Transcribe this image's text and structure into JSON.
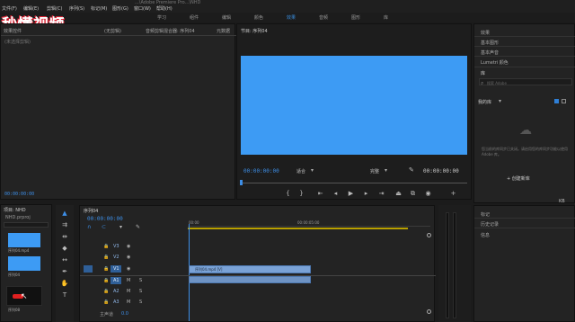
{
  "logo": "秒懂视频",
  "title_partial": "...\\Adobe Premiere Pro...\\NHD",
  "menu": [
    "文件(F)",
    "编辑(E)",
    "剪辑(C)",
    "序列(S)",
    "标记(M)",
    "图形(G)",
    "窗口(W)",
    "帮助(H)"
  ],
  "workspaces": [
    "学习",
    "组件",
    "编辑",
    "颜色",
    "效果",
    "音频",
    "图形",
    "库"
  ],
  "active_workspace": "效果",
  "source_panel": {
    "tabs": [
      "效果控件",
      "(无剪辑)",
      "音频剪辑混合器: 序列04",
      "元数据"
    ],
    "empty_text": "(未选择剪辑)",
    "timecode": "00:00:00:00"
  },
  "program_panel": {
    "title": "节目: 序列04",
    "timecode_left": "00:00:00:00",
    "fit": "适合",
    "quality": "完整",
    "timecode_right": "00:00:00:00",
    "screen_color": "#3d9bf4"
  },
  "right_panel": {
    "items": [
      "效果",
      "基本图形",
      "基本声音",
      "Lumetri 颜色"
    ],
    "library_label": "库",
    "search_placeholder": "搜索 Adobe",
    "my_libraries": "我的库",
    "message": "您当前的库同步已关闭。请启用您的库同步功能以使用 Adobe 库。",
    "create_button": "+ 创建新库",
    "bottom_items": [
      "标记",
      "历史记录",
      "信息"
    ],
    "kb_label": "KB"
  },
  "project_panel": {
    "title": "项目: NHD",
    "file": "NHD.prproj",
    "items": [
      "序列04.mp4",
      "序列04",
      "序列08"
    ]
  },
  "timeline": {
    "title": "序列04",
    "timecode": "00:00:00:00",
    "ruler_start": "00:00",
    "ruler_mark": "00:00:05:00",
    "video_tracks": [
      "V3",
      "V2",
      "V1"
    ],
    "audio_tracks": [
      "A1",
      "A2",
      "A3"
    ],
    "master": "主声道",
    "master_value": "0.0",
    "clip_label": "序列04.mp4 [V]"
  }
}
